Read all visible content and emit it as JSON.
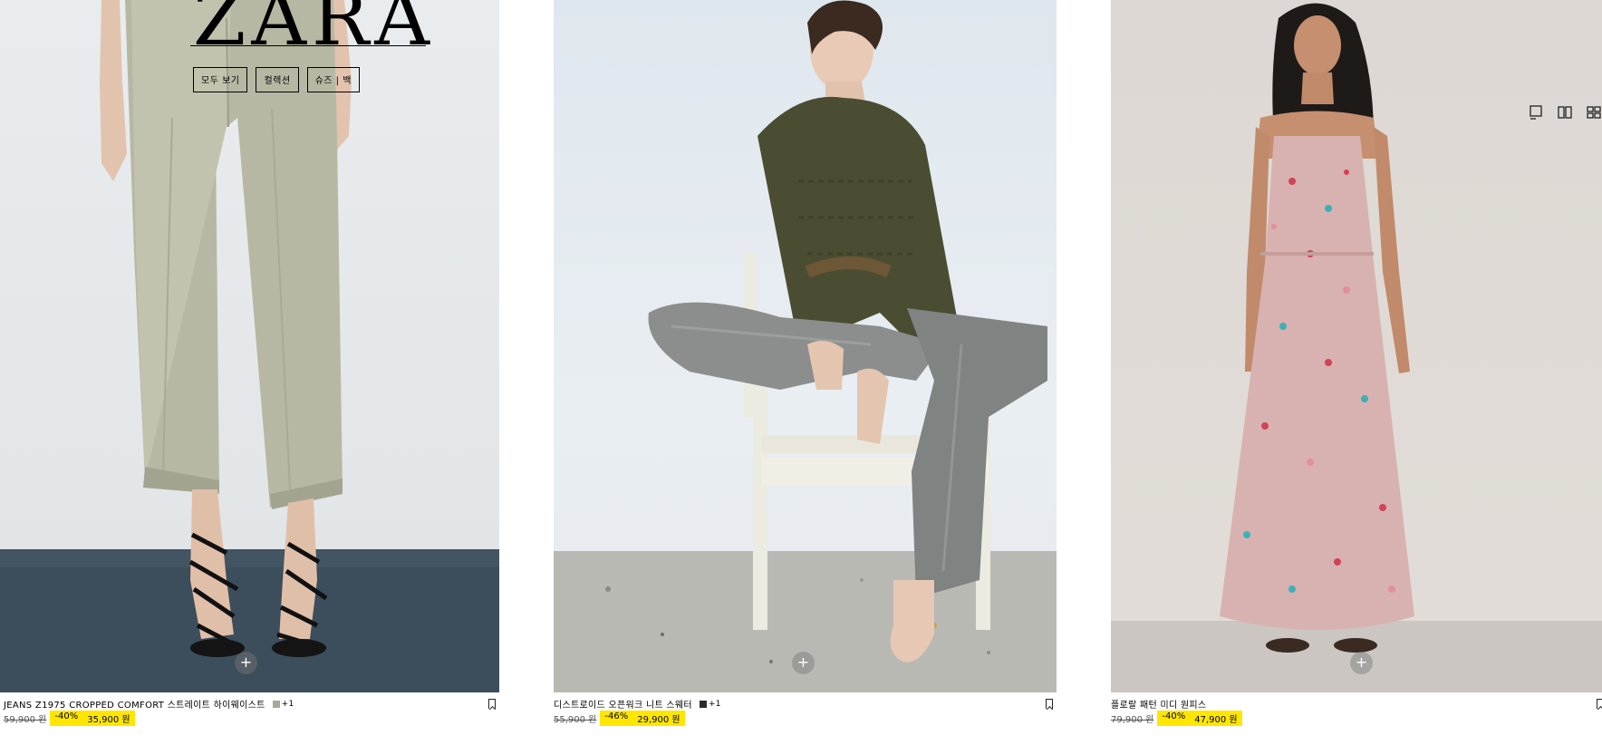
{
  "brand": {
    "logo_text": "ZARA"
  },
  "nav": {
    "items": [
      {
        "label": "모두 보기"
      },
      {
        "label": "컬렉션"
      },
      {
        "label": "슈즈 | 백"
      }
    ]
  },
  "view_options": [
    {
      "icon": "single-column-view-icon"
    },
    {
      "icon": "two-column-view-icon"
    },
    {
      "icon": "grid-view-icon"
    }
  ],
  "products": [
    {
      "name": "JEANS Z1975 CROPPED COMFORT 스트레이트 하이웨이스트",
      "swatch_color": "#a8a89a",
      "swatch_more": "+1",
      "old_price": "59,900 원",
      "discount": "-40%",
      "sale_price": "35,900 원",
      "add_symbol": "+"
    },
    {
      "name": "디스트로이드 오픈워크 니트 스웨터",
      "swatch_color": "#2b2b2b",
      "swatch_more": "+1",
      "old_price": "55,900 원",
      "discount": "-46%",
      "sale_price": "29,900 원",
      "add_symbol": "+"
    },
    {
      "name": "플로랄 패턴 미디 원피스",
      "old_price": "79,900 원",
      "discount": "-40%",
      "sale_price": "47,900 원",
      "add_symbol": "+"
    }
  ]
}
